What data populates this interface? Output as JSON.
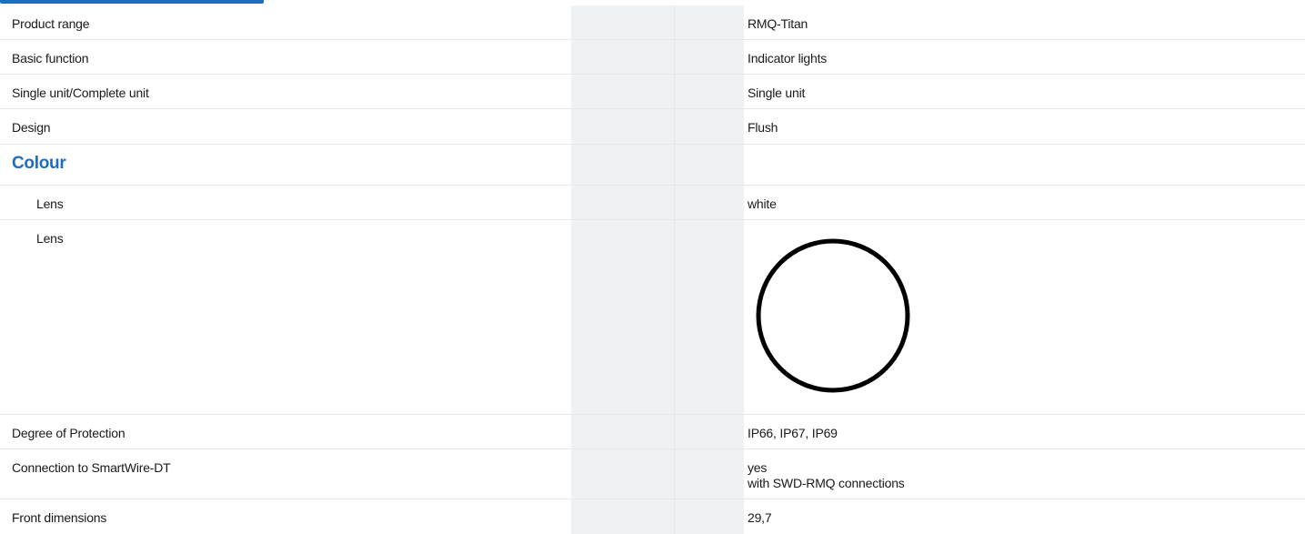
{
  "rows": {
    "product_range": {
      "label": "Product range",
      "value": "RMQ-Titan"
    },
    "basic_function": {
      "label": "Basic function",
      "value": "Indicator lights"
    },
    "single_complete": {
      "label": "Single unit/Complete unit",
      "value": "Single unit"
    },
    "design": {
      "label": "Design",
      "value": "Flush"
    },
    "colour_heading": {
      "label": "Colour"
    },
    "lens_colour": {
      "label": "Lens",
      "value": "white"
    },
    "lens_swatch": {
      "label": "Lens",
      "swatch_icon": "circle-outline-icon",
      "swatch_fill": "#ffffff",
      "swatch_stroke": "#000000"
    },
    "protection": {
      "label": "Degree of Protection",
      "value": "IP66, IP67, IP69"
    },
    "smartwire": {
      "label": "Connection to SmartWire-DT",
      "value_line1": "yes",
      "value_line2": "with SWD-RMQ connections"
    },
    "front_dimensions": {
      "label": "Front dimensions",
      "value": "29,7"
    }
  },
  "colors": {
    "accent": "#1e6cc0",
    "column_shade": "#eff2f5",
    "row_divider": "#e6e8eb"
  }
}
